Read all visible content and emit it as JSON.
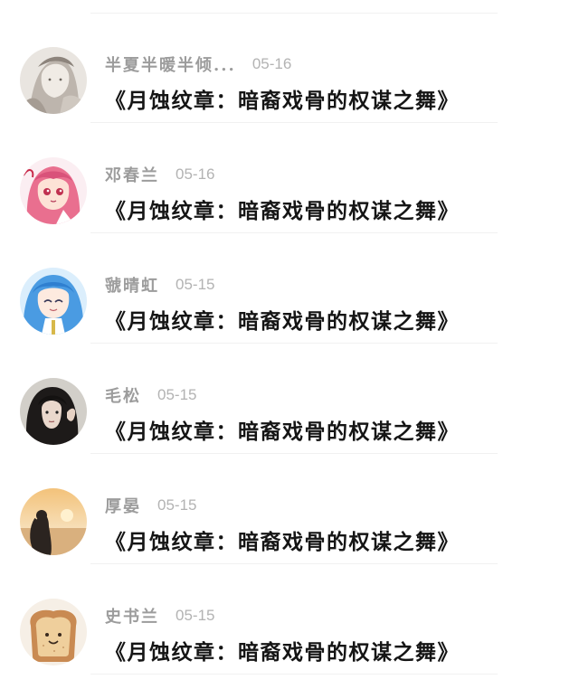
{
  "comments": [
    {
      "name": "半夏半暖半倾...",
      "date": "05-16",
      "text": "《月蚀纹章：暗裔戏骨的权谋之舞》",
      "avatar_icon": "avatar-ink-sketch"
    },
    {
      "name": "邓春兰",
      "date": "05-16",
      "text": "《月蚀纹章：暗裔戏骨的权谋之舞》",
      "avatar_icon": "avatar-pink-anime-girl"
    },
    {
      "name": "虢晴虹",
      "date": "05-15",
      "text": "《月蚀纹章：暗裔戏骨的权谋之舞》",
      "avatar_icon": "avatar-blue-anime-girl"
    },
    {
      "name": "毛松",
      "date": "05-15",
      "text": "《月蚀纹章：暗裔戏骨的权谋之舞》",
      "avatar_icon": "avatar-dark-hair-portrait"
    },
    {
      "name": "厚晏",
      "date": "05-15",
      "text": "《月蚀纹章：暗裔戏骨的权谋之舞》",
      "avatar_icon": "avatar-sunset-silhouette"
    },
    {
      "name": "史书兰",
      "date": "05-15",
      "text": "《月蚀纹章：暗裔戏骨的权谋之舞》",
      "avatar_icon": "avatar-toast-smile"
    }
  ]
}
